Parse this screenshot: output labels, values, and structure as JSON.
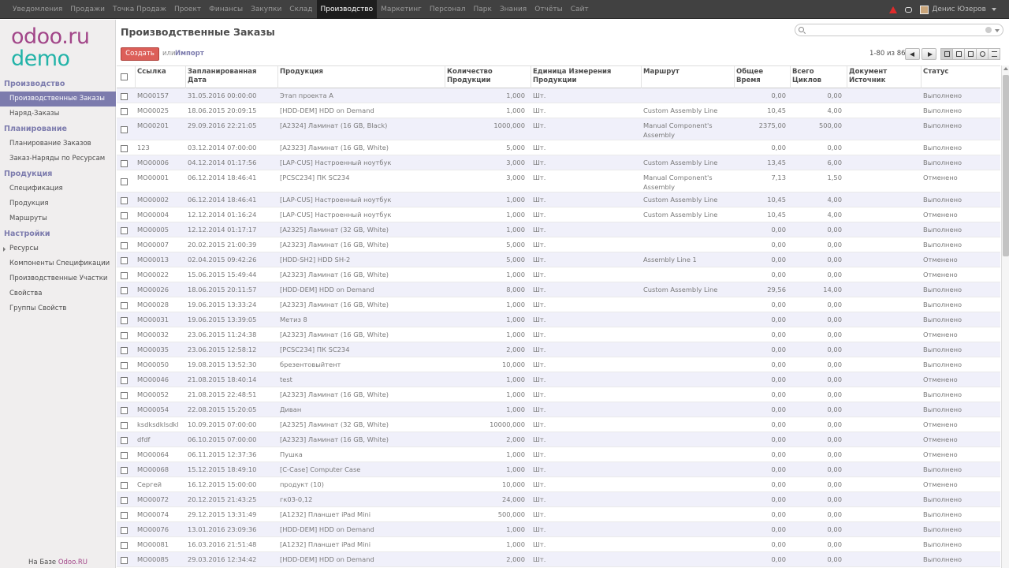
{
  "topmenu": [
    "Уведомления",
    "Продажи",
    "Точка Продаж",
    "Проект",
    "Финансы",
    "Закупки",
    "Склад",
    "Производство",
    "Маркетинг",
    "Персонал",
    "Парк",
    "Знания",
    "Отчёты",
    "Сайт"
  ],
  "topmenu_active": 7,
  "user_name": "Денис Юзеров",
  "logo": {
    "line1": "odoo.ru",
    "line2": "demo"
  },
  "sidebar": [
    {
      "type": "sec",
      "label": "Производство"
    },
    {
      "type": "item",
      "label": "Производственные Заказы",
      "active": true
    },
    {
      "type": "item",
      "label": "Наряд-Заказы"
    },
    {
      "type": "sec",
      "label": "Планирование"
    },
    {
      "type": "item",
      "label": "Планирование Заказов"
    },
    {
      "type": "item",
      "label": "Заказ-Наряды по Ресурсам"
    },
    {
      "type": "sec",
      "label": "Продукция"
    },
    {
      "type": "item",
      "label": "Спецификация"
    },
    {
      "type": "item",
      "label": "Продукция"
    },
    {
      "type": "item",
      "label": "Маршруты"
    },
    {
      "type": "sec",
      "label": "Настройки"
    },
    {
      "type": "item",
      "label": "Ресурсы",
      "expand": true
    },
    {
      "type": "item",
      "label": "Компоненты Спецификации"
    },
    {
      "type": "item",
      "label": "Производственные Участки"
    },
    {
      "type": "item",
      "label": "Свойства"
    },
    {
      "type": "item",
      "label": "Группы Свойств"
    }
  ],
  "footer": {
    "prefix": "На Базе ",
    "brand": "Odoo.RU"
  },
  "page_title": "Производственные Заказы",
  "create_label": "Создать",
  "or_label": "или",
  "import_label": "Импорт",
  "pager_text": "1-80 из 86",
  "columns": [
    "Ссылка",
    "Запланированная Дата",
    "Продукция",
    "Количество Продукции",
    "Единица Измерения Продукции",
    "Маршрут",
    "Общее Время",
    "Всего Циклов",
    "Документ Источник",
    "Статус"
  ],
  "rows": [
    [
      "MO00157",
      "31.05.2016 00:00:00",
      "Этап проекта A",
      "1,000",
      "Шт.",
      "",
      "0,00",
      "0,00",
      "",
      "Выполнено"
    ],
    [
      "MO00025",
      "18.06.2015 20:09:15",
      "[HDD-DEM] HDD on Demand",
      "1,000",
      "Шт.",
      "Custom Assembly Line",
      "10,45",
      "4,00",
      "",
      "Выполнено"
    ],
    [
      "MO00201",
      "29.09.2016 22:21:05",
      "[A2324] Ламинат (16 GB, Black)",
      "1000,000",
      "Шт.",
      "Manual Component's Assembly",
      "2375,00",
      "500,00",
      "",
      "Выполнено"
    ],
    [
      "123",
      "03.12.2014 07:00:00",
      "[A2323] Ламинат (16 GB, White)",
      "5,000",
      "Шт.",
      "",
      "0,00",
      "0,00",
      "",
      "Выполнено"
    ],
    [
      "MO00006",
      "04.12.2014 01:17:56",
      "[LAP-CUS] Настроенный ноутбук",
      "3,000",
      "Шт.",
      "Custom Assembly Line",
      "13,45",
      "6,00",
      "",
      "Выполнено"
    ],
    [
      "MO00001",
      "06.12.2014 18:46:41",
      "[PCSC234] ПК SC234",
      "3,000",
      "Шт.",
      "Manual Component's Assembly",
      "7,13",
      "1,50",
      "",
      "Отменено"
    ],
    [
      "MO00002",
      "06.12.2014 18:46:41",
      "[LAP-CUS] Настроенный ноутбук",
      "1,000",
      "Шт.",
      "Custom Assembly Line",
      "10,45",
      "4,00",
      "",
      "Выполнено"
    ],
    [
      "MO00004",
      "12.12.2014 01:16:24",
      "[LAP-CUS] Настроенный ноутбук",
      "1,000",
      "Шт.",
      "Custom Assembly Line",
      "10,45",
      "4,00",
      "",
      "Отменено"
    ],
    [
      "MO00005",
      "12.12.2014 01:17:17",
      "[A2325] Ламинат (32 GB, White)",
      "1,000",
      "Шт.",
      "",
      "0,00",
      "0,00",
      "",
      "Выполнено"
    ],
    [
      "MO00007",
      "20.02.2015 21:00:39",
      "[A2323] Ламинат (16 GB, White)",
      "5,000",
      "Шт.",
      "",
      "0,00",
      "0,00",
      "",
      "Выполнено"
    ],
    [
      "MO00013",
      "02.04.2015 09:42:26",
      "[HDD-SH2] HDD SH-2",
      "5,000",
      "Шт.",
      "Assembly Line 1",
      "0,00",
      "0,00",
      "",
      "Отменено"
    ],
    [
      "MO00022",
      "15.06.2015 15:49:44",
      "[A2323] Ламинат (16 GB, White)",
      "1,000",
      "Шт.",
      "",
      "0,00",
      "0,00",
      "",
      "Отменено"
    ],
    [
      "MO00026",
      "18.06.2015 20:11:57",
      "[HDD-DEM] HDD on Demand",
      "8,000",
      "Шт.",
      "Custom Assembly Line",
      "29,56",
      "14,00",
      "",
      "Выполнено"
    ],
    [
      "MO00028",
      "19.06.2015 13:33:24",
      "[A2323] Ламинат (16 GB, White)",
      "1,000",
      "Шт.",
      "",
      "0,00",
      "0,00",
      "",
      "Выполнено"
    ],
    [
      "MO00031",
      "19.06.2015 13:39:05",
      "Метиз 8",
      "1,000",
      "Шт.",
      "",
      "0,00",
      "0,00",
      "",
      "Выполнено"
    ],
    [
      "MO00032",
      "23.06.2015 11:24:38",
      "[A2323] Ламинат (16 GB, White)",
      "1,000",
      "Шт.",
      "",
      "0,00",
      "0,00",
      "",
      "Отменено"
    ],
    [
      "MO00035",
      "23.06.2015 12:58:12",
      "[PCSC234] ПК SC234",
      "2,000",
      "Шт.",
      "",
      "0,00",
      "0,00",
      "",
      "Выполнено"
    ],
    [
      "MO00050",
      "19.08.2015 13:52:30",
      "брезентовыйтент",
      "10,000",
      "Шт.",
      "",
      "0,00",
      "0,00",
      "",
      "Выполнено"
    ],
    [
      "MO00046",
      "21.08.2015 18:40:14",
      "test",
      "1,000",
      "Шт.",
      "",
      "0,00",
      "0,00",
      "",
      "Отменено"
    ],
    [
      "MO00052",
      "21.08.2015 22:48:51",
      "[A2323] Ламинат (16 GB, White)",
      "1,000",
      "Шт.",
      "",
      "0,00",
      "0,00",
      "",
      "Выполнено"
    ],
    [
      "MO00054",
      "22.08.2015 15:20:05",
      "Диван",
      "1,000",
      "Шт.",
      "",
      "0,00",
      "0,00",
      "",
      "Выполнено"
    ],
    [
      "ksdksdklsdkl",
      "10.09.2015 07:00:00",
      "[A2325] Ламинат (32 GB, White)",
      "10000,000",
      "Шт.",
      "",
      "0,00",
      "0,00",
      "",
      "Отменено"
    ],
    [
      "dfdf",
      "06.10.2015 07:00:00",
      "[A2323] Ламинат (16 GB, White)",
      "2,000",
      "Шт.",
      "",
      "0,00",
      "0,00",
      "",
      "Отменено"
    ],
    [
      "MO00064",
      "06.11.2015 12:37:36",
      "Пушка",
      "1,000",
      "Шт.",
      "",
      "0,00",
      "0,00",
      "",
      "Отменено"
    ],
    [
      "MO00068",
      "15.12.2015 18:49:10",
      "[C-Case] Computer Case",
      "1,000",
      "Шт.",
      "",
      "0,00",
      "0,00",
      "",
      "Выполнено"
    ],
    [
      "Сергей",
      "16.12.2015 15:00:00",
      "продукт (10)",
      "10,000",
      "Шт.",
      "",
      "0,00",
      "0,00",
      "",
      "Отменено"
    ],
    [
      "MO00072",
      "20.12.2015 21:43:25",
      "гк03-0,12",
      "24,000",
      "Шт.",
      "",
      "0,00",
      "0,00",
      "",
      "Выполнено"
    ],
    [
      "MO00074",
      "29.12.2015 13:31:49",
      "[A1232] Планшет iPad Mini",
      "500,000",
      "Шт.",
      "",
      "0,00",
      "0,00",
      "",
      "Выполнено"
    ],
    [
      "MO00076",
      "13.01.2016 23:09:36",
      "[HDD-DEM] HDD on Demand",
      "1,000",
      "Шт.",
      "",
      "0,00",
      "0,00",
      "",
      "Выполнено"
    ],
    [
      "MO00081",
      "16.03.2016 21:51:48",
      "[A1232] Планшет iPad Mini",
      "1,000",
      "Шт.",
      "",
      "0,00",
      "0,00",
      "",
      "Выполнено"
    ],
    [
      "MO00085",
      "29.03.2016 12:34:42",
      "[HDD-DEM] HDD on Demand",
      "2,000",
      "Шт.",
      "",
      "0,00",
      "0,00",
      "",
      "Выполнено"
    ]
  ]
}
